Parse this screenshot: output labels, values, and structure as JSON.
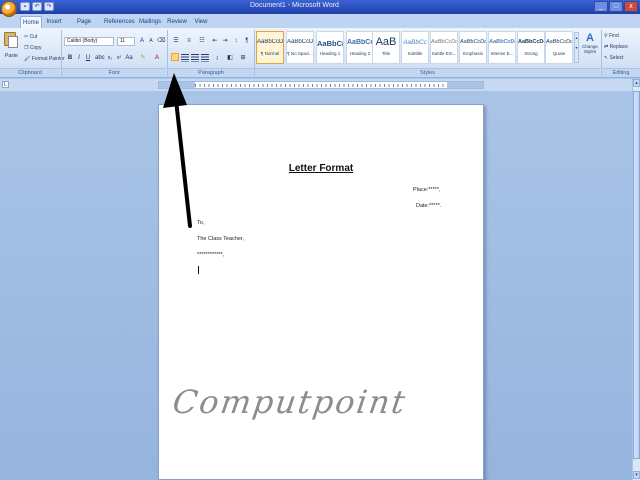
{
  "titlebar": {
    "title": "Document1 - Microsoft Word",
    "quick_access": [
      "save",
      "undo",
      "redo"
    ],
    "controls": [
      "_",
      "□",
      "x"
    ]
  },
  "tabs": [
    "Home",
    "Insert",
    "Page Layout",
    "References",
    "Mailings",
    "Review",
    "View"
  ],
  "active_tab": "Home",
  "clipboard": {
    "paste_label": "Paste",
    "cut_label": "Cut",
    "copy_label": "Copy",
    "format_painter_label": "Format Painter",
    "group_label": "Clipboard"
  },
  "font": {
    "font_name": "Calibri (Body)",
    "font_size": "11",
    "group_label": "Font"
  },
  "paragraph": {
    "group_label": "Paragraph"
  },
  "styles": {
    "group_label": "Styles",
    "items": [
      {
        "sample": "AaBbCcDc",
        "name": "¶ Normal",
        "selected": true
      },
      {
        "sample": "AaBbCcDc",
        "name": "¶ No Spaci...",
        "selected": false
      },
      {
        "sample": "AaBbC(",
        "name": "Heading 1",
        "selected": false
      },
      {
        "sample": "AaBbCc",
        "name": "Heading 2",
        "selected": false
      },
      {
        "sample": "AaB",
        "name": "Title",
        "selected": false
      },
      {
        "sample": "AaBbCc",
        "name": "Subtitle",
        "selected": false
      },
      {
        "sample": "AaBbCcDc",
        "name": "Subtle Em...",
        "selected": false
      },
      {
        "sample": "AaBbCcDc",
        "name": "Emphasis",
        "selected": false
      },
      {
        "sample": "AaBbCcDc",
        "name": "Intense E...",
        "selected": false
      },
      {
        "sample": "AaBbCcDc",
        "name": "Strong",
        "selected": false
      },
      {
        "sample": "AaBbCcDc",
        "name": "Quote",
        "selected": false
      }
    ],
    "change_styles_label": "Change Styles"
  },
  "editing": {
    "find_label": "Find",
    "replace_label": "Replace",
    "select_label": "Select",
    "group_label": "Editing"
  },
  "document": {
    "title": "Letter Format",
    "place": "Place:*****,",
    "date": "Date:*****.",
    "to": "To,",
    "recipient": "The Class Teacher,",
    "stars": "************,",
    "watermark": "Computpoint"
  },
  "annotation": {
    "color": "#000000",
    "points_to": "align-left-button"
  },
  "colors": {
    "ribbon_bg": "#d5e3f6",
    "titlebar": "#2f51c4",
    "workspace": "#a9c4e6",
    "highlight": "#ffd77a"
  }
}
